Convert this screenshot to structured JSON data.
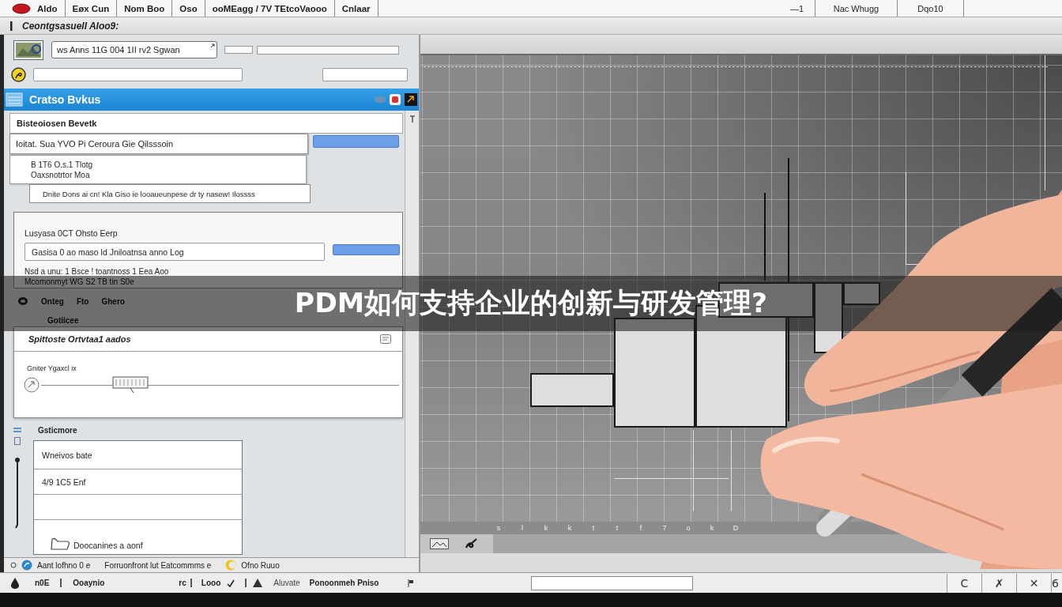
{
  "menu_bar": {
    "items": [
      "Aldo",
      "Eøx Cun",
      "Nom Boo",
      "Oso",
      "ooMEagg / 7V TEtcoVaooo",
      "Cnlaar"
    ],
    "right_items": [
      "—1",
      "Nac Whugg",
      "Dqo10"
    ]
  },
  "path_bar": {
    "text": "Ceontgsasuell Aloo9:"
  },
  "toolbar": {
    "dropdown_value": "ws Anns 11G 004 1II rv2 Sgwan"
  },
  "panel": {
    "title": "Cratso Bvkus",
    "section_1": {
      "heading": "Bisteoiosen Bevetk",
      "field_value": "Ioitat. Sua YVO Pi Ceroura Gie Qilsssoin",
      "note_lines": [
        "B 1T6 O.s.1 Tlotg",
        "Oaxsnotrtor Moa"
      ],
      "detail": "Dnite Dons ai cn! Kla Giso ie looaueunpese dr ty nasew! Ilossss"
    },
    "section_2": {
      "label": "Lusyasa 0CT Ohsto Eerp",
      "field_value": "Gasisa 0 ao maso ld Jniloatnsa anno Log",
      "lines": [
        "Nsd a unu: 1 Bsce ! toantnoss 1 Eea Aoo",
        "Mcomonmyt WG S2 TB tin S0e"
      ]
    },
    "actions": [
      "Onteg",
      "Fto",
      "Ghero"
    ],
    "group": {
      "label": "Gotiicee",
      "row_text": "Spittoste Ortvtaa1 aados",
      "slider": {
        "label": "Gniter Ygaxcl ix",
        "level": 0.25
      }
    },
    "list": {
      "label": "Gsticmore",
      "rows": [
        {
          "kind": "text",
          "text": "Wneivos bate"
        },
        {
          "kind": "text",
          "text": "4/9 1C5 Enf"
        },
        {
          "kind": "blank"
        },
        {
          "kind": "icon",
          "text": "Doocanines a aonf"
        }
      ]
    },
    "status": [
      {
        "kind": "info",
        "text": "Aant lofhno 0 e"
      },
      {
        "kind": "plain",
        "text": "Forruonfront lut Eatcommms e"
      },
      {
        "kind": "warning",
        "text": "Ofno Ruuo"
      }
    ]
  },
  "canvas": {
    "ruler_labels": [
      "s",
      "l",
      "k",
      "k",
      "t",
      "t",
      "f",
      "7",
      "o",
      "k",
      "D"
    ]
  },
  "banner": {
    "title": "PDM如何支持企业的创新与研发管理?"
  },
  "taskbar": {
    "items": [
      {
        "kind": "drop",
        "text": "n0E"
      },
      {
        "kind": "divider",
        "text": "Ooaynio"
      },
      {
        "kind": "plain",
        "text": "rc"
      },
      {
        "kind": "check",
        "text": "Looo"
      },
      {
        "kind": "triangle",
        "text": "Aluvate"
      },
      {
        "kind": "plain",
        "text": "Ponoonmeh Pniso"
      }
    ],
    "buttons": [
      "C",
      "✗",
      "✕",
      "6"
    ]
  }
}
